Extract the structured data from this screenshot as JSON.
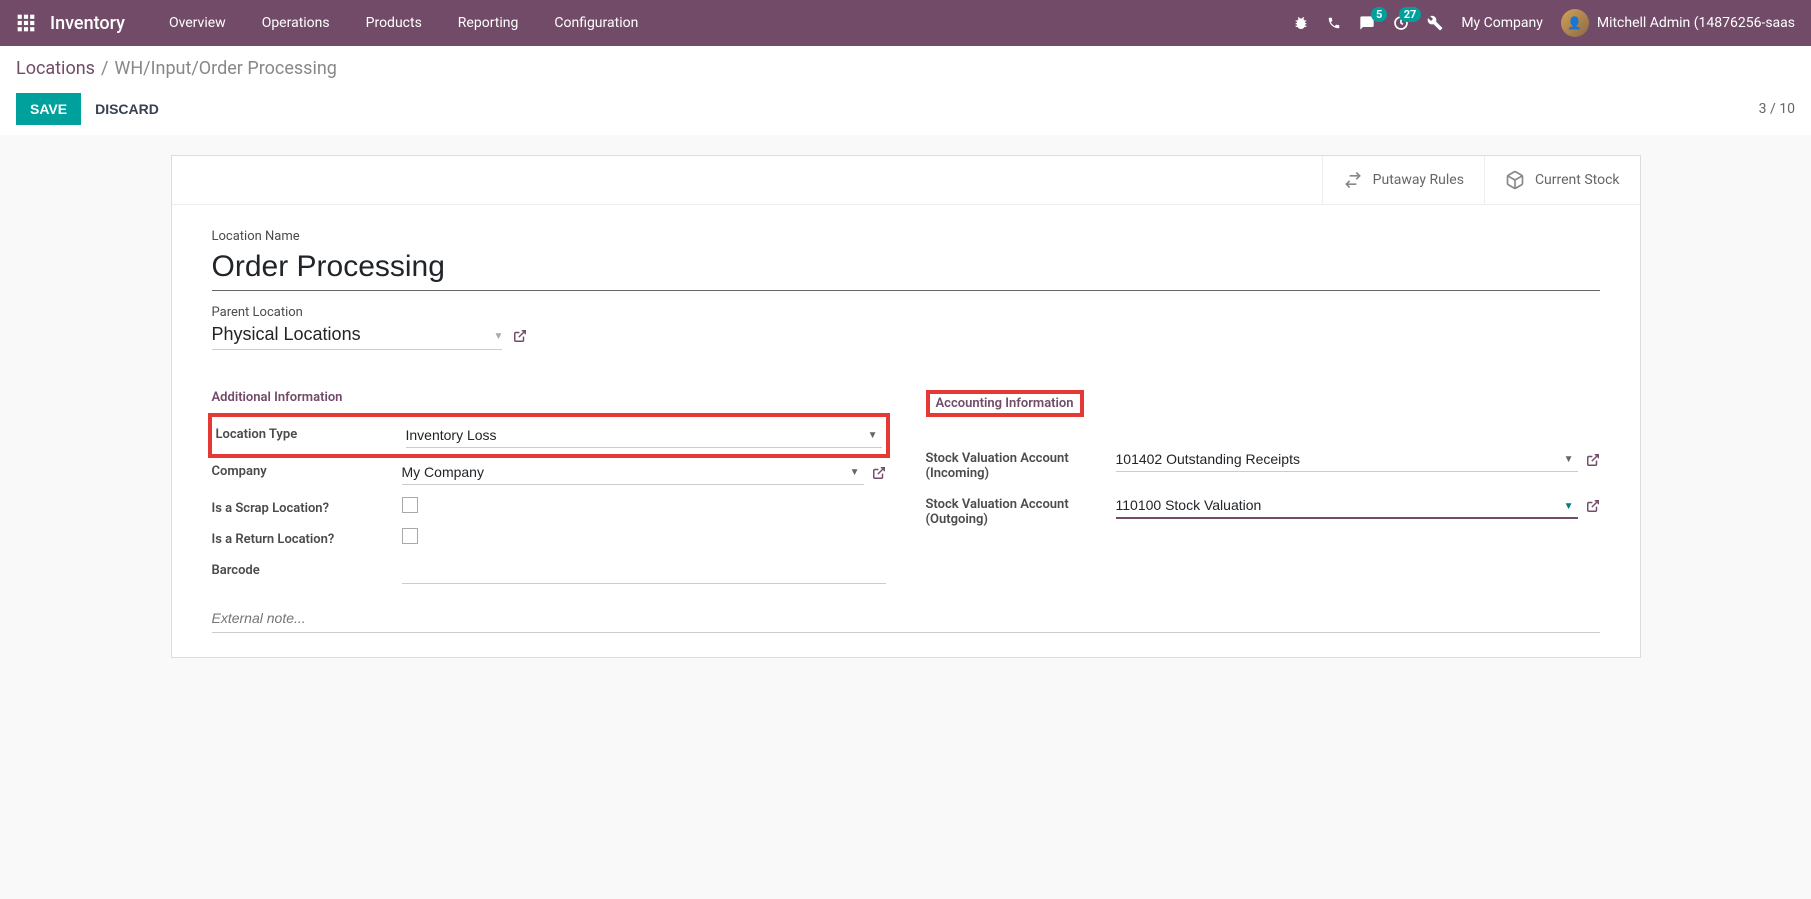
{
  "navbar": {
    "brand": "Inventory",
    "menu": [
      "Overview",
      "Operations",
      "Products",
      "Reporting",
      "Configuration"
    ],
    "messages_badge": "5",
    "activities_badge": "27",
    "company": "My Company",
    "user": "Mitchell Admin (14876256-saas"
  },
  "breadcrumb": {
    "link": "Locations",
    "active": "WH/Input/Order Processing"
  },
  "buttons": {
    "save": "SAVE",
    "discard": "DISCARD"
  },
  "pager": "3 / 10",
  "stat_buttons": {
    "putaway": "Putaway Rules",
    "stock": "Current Stock"
  },
  "form": {
    "name_label": "Location Name",
    "name_value": "Order Processing",
    "parent_label": "Parent Location",
    "parent_value": "Physical Locations",
    "group1_title": "Additional Information",
    "location_type_label": "Location Type",
    "location_type_value": "Inventory Loss",
    "company_label": "Company",
    "company_value": "My Company",
    "scrap_label": "Is a Scrap Location?",
    "return_label": "Is a Return Location?",
    "barcode_label": "Barcode",
    "barcode_value": "",
    "group2_title": "Accounting Information",
    "sv_in_label": "Stock Valuation Account (Incoming)",
    "sv_in_value": "101402 Outstanding Receipts",
    "sv_out_label": "Stock Valuation Account (Outgoing)",
    "sv_out_value": "110100 Stock Valuation",
    "notes_placeholder": "External note..."
  }
}
